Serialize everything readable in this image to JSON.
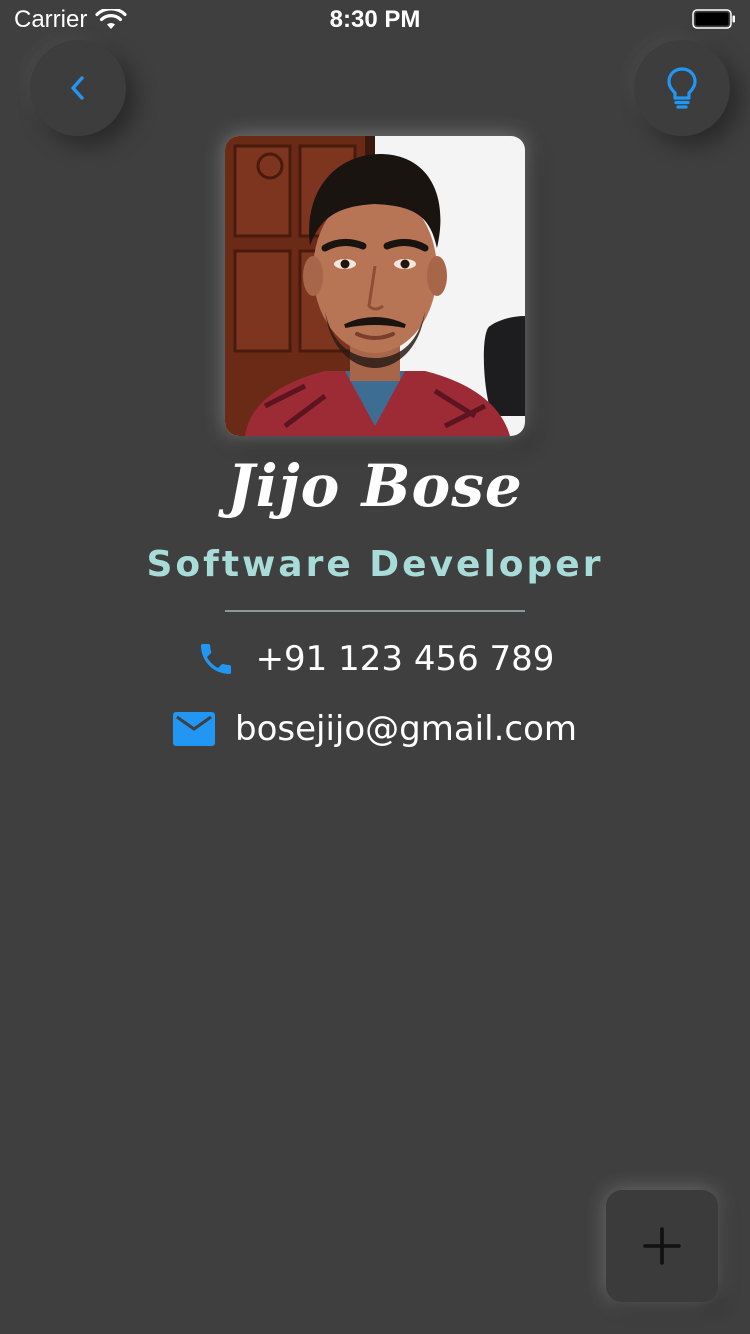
{
  "status_bar": {
    "carrier": "Carrier",
    "time": "8:30 PM"
  },
  "header": {
    "back_icon": "chevron-left-icon",
    "theme_icon": "lightbulb-icon"
  },
  "profile": {
    "name": "Jijo Bose",
    "title": "Software Developer",
    "phone": "+91 123 456 789",
    "email": "bosejijo@gmail.com"
  },
  "fab": {
    "icon": "plus-icon"
  },
  "colors": {
    "background": "#3f3f3f",
    "accent_blue": "#2196f3",
    "title_teal": "#a7dcd8",
    "text": "#ffffff"
  }
}
